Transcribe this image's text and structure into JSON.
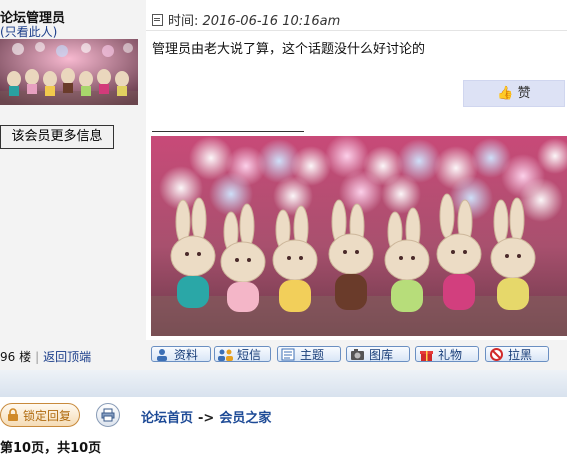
{
  "post": {
    "author": "论坛管理员",
    "only_view": "(只看此人)",
    "more_info": "该会员更多信息",
    "time_label": "时间:",
    "time_value": "2016-06-16 10:16am",
    "message": "管理员由老大说了算，这个话题没什么好讨论的",
    "like_label": "赞",
    "floor_label": "96 楼",
    "back_top": "返回顶端"
  },
  "actions": [
    {
      "label": "资料",
      "icon": "profile-icon"
    },
    {
      "label": "短信",
      "icon": "users-icon"
    },
    {
      "label": "主题",
      "icon": "topics-icon"
    },
    {
      "label": "图库",
      "icon": "camera-icon"
    },
    {
      "label": "礼物",
      "icon": "gift-icon"
    },
    {
      "label": "拉黑",
      "icon": "block-icon"
    }
  ],
  "footer": {
    "lock_reply": "锁定回复",
    "breadcrumb_home": "论坛首页",
    "breadcrumb_arrow": "->",
    "breadcrumb_current": "会员之家",
    "page_info": "第10页，共10页"
  },
  "colors": {
    "link": "#1a3d8a",
    "like_bg": "#dde2f5",
    "panel_bg": "#f3f3f3",
    "lock_text": "#b06b10"
  }
}
